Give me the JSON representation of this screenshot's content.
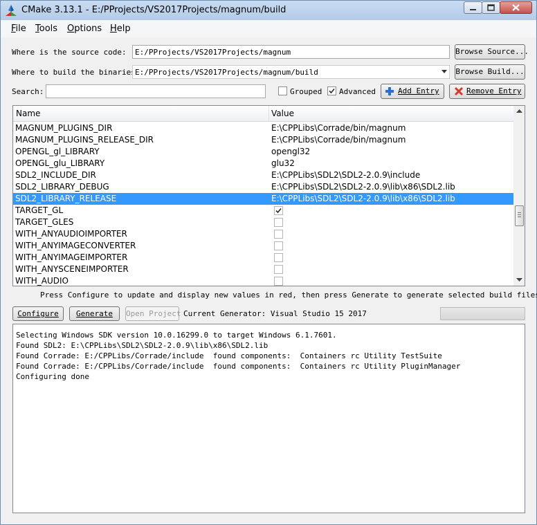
{
  "window": {
    "title": "CMake 3.13.1 - E:/PProjects/VS2017Projects/magnum/build"
  },
  "menu": [
    {
      "label": "File",
      "key": "F",
      "rest": "ile"
    },
    {
      "label": "Tools",
      "key": "T",
      "rest": "ools"
    },
    {
      "label": "Options",
      "key": "O",
      "rest": "ptions"
    },
    {
      "label": "Help",
      "key": "H",
      "rest": "elp"
    }
  ],
  "source": {
    "label": "Where is the source code:",
    "value": "E:/PProjects/VS2017Projects/magnum",
    "browse_button": "Browse Source..."
  },
  "build": {
    "label": "Where to build the binaries:",
    "value": "E:/PProjects/VS2017Projects/magnum/build",
    "browse_button": "Browse Build..."
  },
  "search": {
    "label": "Search:",
    "value": "",
    "grouped_label": "Grouped",
    "grouped_checked": false,
    "advanced_label": "Advanced",
    "advanced_checked": true,
    "add_entry": "Add Entry",
    "remove_entry": "Remove Entry"
  },
  "table": {
    "headers": {
      "name": "Name",
      "value": "Value"
    },
    "rows": [
      {
        "name": "MAGNUM_PLUGINS_DIR",
        "value": "E:\\CPPLibs\\Corrade/bin/magnum",
        "type": "text"
      },
      {
        "name": "MAGNUM_PLUGINS_RELEASE_DIR",
        "value": "E:\\CPPLibs\\Corrade/bin/magnum",
        "type": "text"
      },
      {
        "name": "OPENGL_gl_LIBRARY",
        "value": "opengl32",
        "type": "text"
      },
      {
        "name": "OPENGL_glu_LIBRARY",
        "value": "glu32",
        "type": "text"
      },
      {
        "name": "SDL2_INCLUDE_DIR",
        "value": "E:\\CPPLibs\\SDL2\\SDL2-2.0.9\\include",
        "type": "text"
      },
      {
        "name": "SDL2_LIBRARY_DEBUG",
        "value": "E:\\CPPLibs\\SDL2\\SDL2-2.0.9\\lib\\x86\\SDL2.lib",
        "type": "text"
      },
      {
        "name": "SDL2_LIBRARY_RELEASE",
        "value": "E:\\CPPLibs\\SDL2\\SDL2-2.0.9\\lib\\x86\\SDL2.lib",
        "type": "text",
        "selected": true
      },
      {
        "name": "TARGET_GL",
        "checked": true,
        "type": "bool"
      },
      {
        "name": "TARGET_GLES",
        "checked": false,
        "type": "bool"
      },
      {
        "name": "WITH_ANYAUDIOIMPORTER",
        "checked": false,
        "type": "bool"
      },
      {
        "name": "WITH_ANYIMAGECONVERTER",
        "checked": false,
        "type": "bool"
      },
      {
        "name": "WITH_ANYIMAGEIMPORTER",
        "checked": false,
        "type": "bool"
      },
      {
        "name": "WITH_ANYSCENEIMPORTER",
        "checked": false,
        "type": "bool"
      },
      {
        "name": "WITH_AUDIO",
        "checked": false,
        "type": "bool"
      }
    ]
  },
  "hint": "Press Configure to update and display new values in red, then press Generate to generate selected build files.",
  "actions": {
    "configure": "Configure",
    "generate": "Generate",
    "open_project": "Open Project",
    "generator_text": "Current Generator: Visual Studio 15 2017"
  },
  "output": {
    "lines": [
      "Selecting Windows SDK version 10.0.16299.0 to target Windows 6.1.7601.",
      "Found SDL2: E:\\CPPLibs\\SDL2\\SDL2-2.0.9\\lib\\x86\\SDL2.lib",
      "Found Corrade: E:/CPPLibs/Corrade/include  found components:  Containers rc Utility TestSuite",
      "Found Corrade: E:/CPPLibs/Corrade/include  found components:  Containers rc Utility PluginManager",
      "Configuring done"
    ]
  },
  "colors": {
    "selection": "#3399ff",
    "titlebar": "#c9dcf2",
    "close_button": "#c75050"
  }
}
